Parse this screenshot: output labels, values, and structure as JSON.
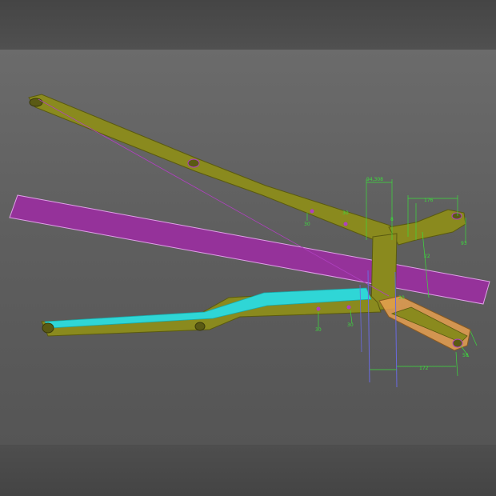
{
  "viewport": {
    "background": "#5f5f5f",
    "frame_bands": "#4a4a4a"
  },
  "colors": {
    "link_body": "#8a8a1e",
    "link_body_dark": "#6e6e14",
    "section_plane": "#9a2fa0",
    "section_plane_edge": "#e0a0e8",
    "highlight_face": "#2fd6d6",
    "accent_part": "#e8a050",
    "dimension": "#3cdc3c",
    "construction_line": "#6a6ae0",
    "sketch_line": "#b040c0"
  },
  "dimensions": {
    "d_top": "94,308",
    "d_176": "176",
    "d_30a": "30",
    "d_30b": "30",
    "d_30c": "30",
    "d_30d": "30",
    "d_8": "8",
    "d_93": "93",
    "d_22": "22",
    "d_172": "172",
    "d_20": "20",
    "d_58": "58"
  }
}
